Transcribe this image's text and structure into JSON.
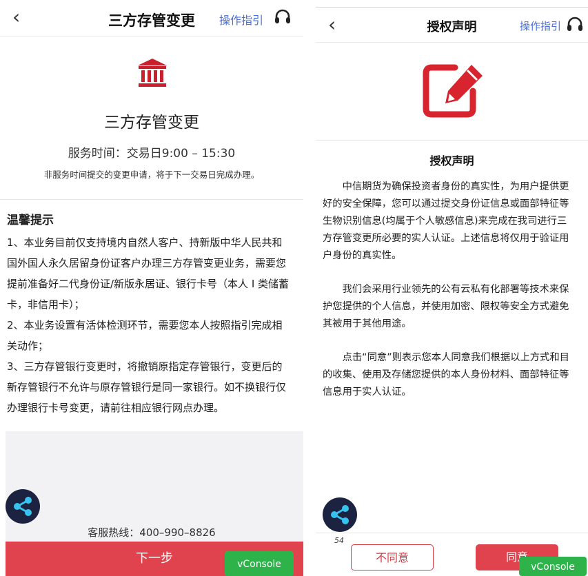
{
  "left": {
    "nav": {
      "back_glyph": "‹",
      "title": "三方存管变更",
      "guide": "操作指引",
      "support_icon": "headset-icon"
    },
    "hero_icon": "bank-icon",
    "heading": "三方存管变更",
    "service_time": "服务时间：交易日9:00 – 15:30",
    "service_note": "非服务时间提交的变更申请，将于下一交易日完成办理。",
    "tips_title": "温馨提示",
    "tips": [
      "1、本业务目前仅支持境内自然人客户、持新版中华人民共和国外国人永久居留身份证客户办理三方存管变更业务，需要您提前准备好二代身份证/新版永居证、银行卡号（本人 I 类储蓄卡，非信用卡）；",
      "2、本业务设置有活体检测环节，需要您本人按照指引完成相关动作；",
      "3、三方存管银行变更时，将撤销原指定存管银行，变更后的新存管银行不允许与原存管银行是同一家银行。如不换银行仅办理银行卡号变更，请前往相应银行网点办理。"
    ],
    "hotline": "客服热线：400–990–8826",
    "next_button": "下一步",
    "vconsole": "vConsole"
  },
  "right": {
    "nav": {
      "back_glyph": "‹",
      "title": "授权声明",
      "guide": "操作指引",
      "support_icon": "headset-icon"
    },
    "hero_icon": "edit-icon",
    "heading": "授权声明",
    "paragraphs": [
      "中信期货为确保投资者身份的真实性，为用户提供更好的安全保障，您可以通过提交身份证信息或面部特征等生物识别信息(均属于个人敏感信息)来完成在我司进行三方存管变更所必要的实人认证。上述信息将仅用于验证用户身份的真实性。",
      "我们会采用行业领先的公有云私有化部署等技术来保护您提供的个人信息，并使用加密、限权等安全方式避免其被用于其他用途。",
      "点击“同意”则表示您本人同意我们根据以上方式和目的收集、使用及存储您提供的本人身份材料、面部特征等信息用于实人认证。"
    ],
    "page_number": "54",
    "disagree_button": "不同意",
    "agree_button": "同意",
    "vconsole": "vConsole"
  },
  "colors": {
    "accent_red": "#e0434e",
    "link_blue": "#4a6fd8",
    "vconsole_green": "#2eb34a",
    "float_ball": "#1b2340"
  }
}
